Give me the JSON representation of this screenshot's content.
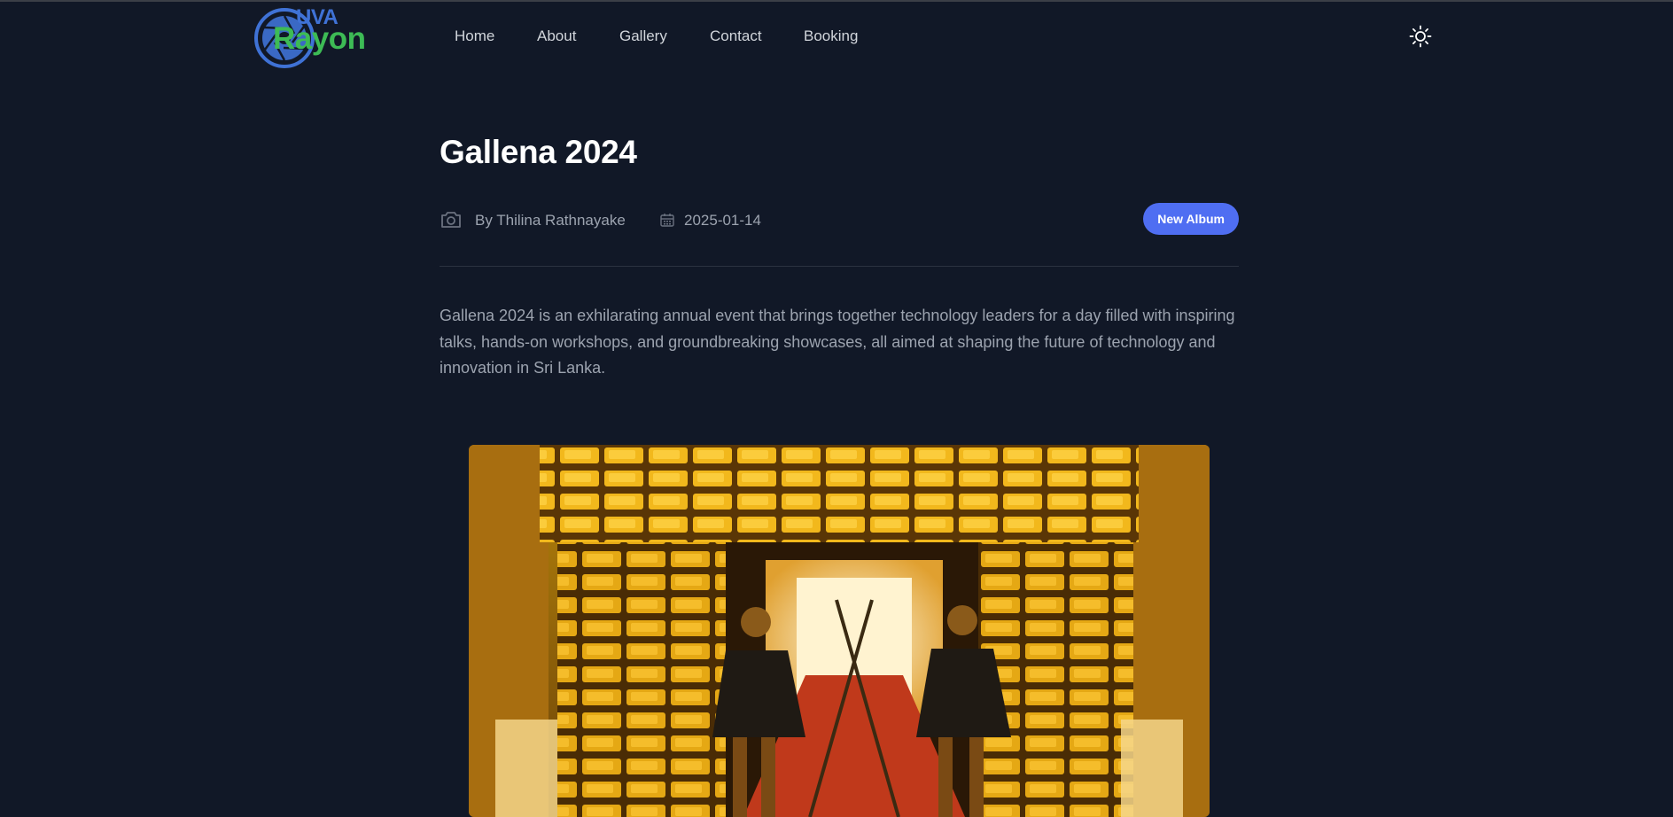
{
  "header": {
    "logo": {
      "top_text": "UVA",
      "main_text": "Rayon"
    },
    "nav": {
      "items": [
        "Home",
        "About",
        "Gallery",
        "Contact",
        "Booking"
      ]
    },
    "theme_toggle_icon": "sun-icon"
  },
  "article": {
    "title": "Gallena 2024",
    "author_icon": "camera-icon",
    "author": "By Thilina Rathnayake",
    "date_icon": "calendar-icon",
    "date": "2025-01-14",
    "badge": "New Album",
    "description": "Gallena 2024 is an exhilarating annual event that brings together technology leaders for a day filled with inspiring talks, hands-on workshops, and groundbreaking showcases, all aimed at shaping the future of technology and innovation in Sri Lanka."
  },
  "colors": {
    "background": "#111827",
    "accent": "#4f6ef2",
    "logo_blue": "#3f72d6",
    "logo_green": "#3dbb55"
  }
}
